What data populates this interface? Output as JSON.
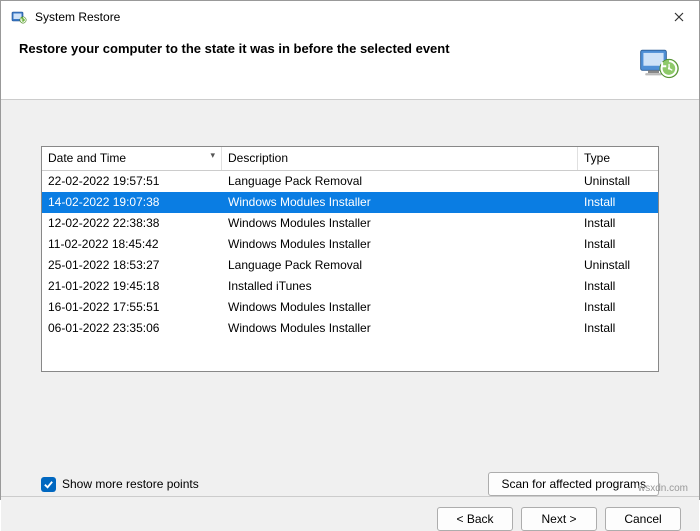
{
  "window": {
    "title": "System Restore",
    "heading": "Restore your computer to the state it was in before the selected event"
  },
  "columns": {
    "date": "Date and Time",
    "desc": "Description",
    "type": "Type"
  },
  "rows": [
    {
      "date": "22-02-2022 19:57:51",
      "desc": "Language Pack Removal",
      "type": "Uninstall",
      "selected": false
    },
    {
      "date": "14-02-2022 19:07:38",
      "desc": "Windows Modules Installer",
      "type": "Install",
      "selected": true
    },
    {
      "date": "12-02-2022 22:38:38",
      "desc": "Windows Modules Installer",
      "type": "Install",
      "selected": false
    },
    {
      "date": "11-02-2022 18:45:42",
      "desc": "Windows Modules Installer",
      "type": "Install",
      "selected": false
    },
    {
      "date": "25-01-2022 18:53:27",
      "desc": "Language Pack Removal",
      "type": "Uninstall",
      "selected": false
    },
    {
      "date": "21-01-2022 19:45:18",
      "desc": "Installed iTunes",
      "type": "Install",
      "selected": false
    },
    {
      "date": "16-01-2022 17:55:51",
      "desc": "Windows Modules Installer",
      "type": "Install",
      "selected": false
    },
    {
      "date": "06-01-2022 23:35:06",
      "desc": "Windows Modules Installer",
      "type": "Install",
      "selected": false
    }
  ],
  "checkbox": {
    "label": "Show more restore points",
    "checked": true
  },
  "buttons": {
    "scan": "Scan for affected programs",
    "back": "< Back",
    "next": "Next >",
    "cancel": "Cancel"
  },
  "watermark": "wsxdn.com"
}
